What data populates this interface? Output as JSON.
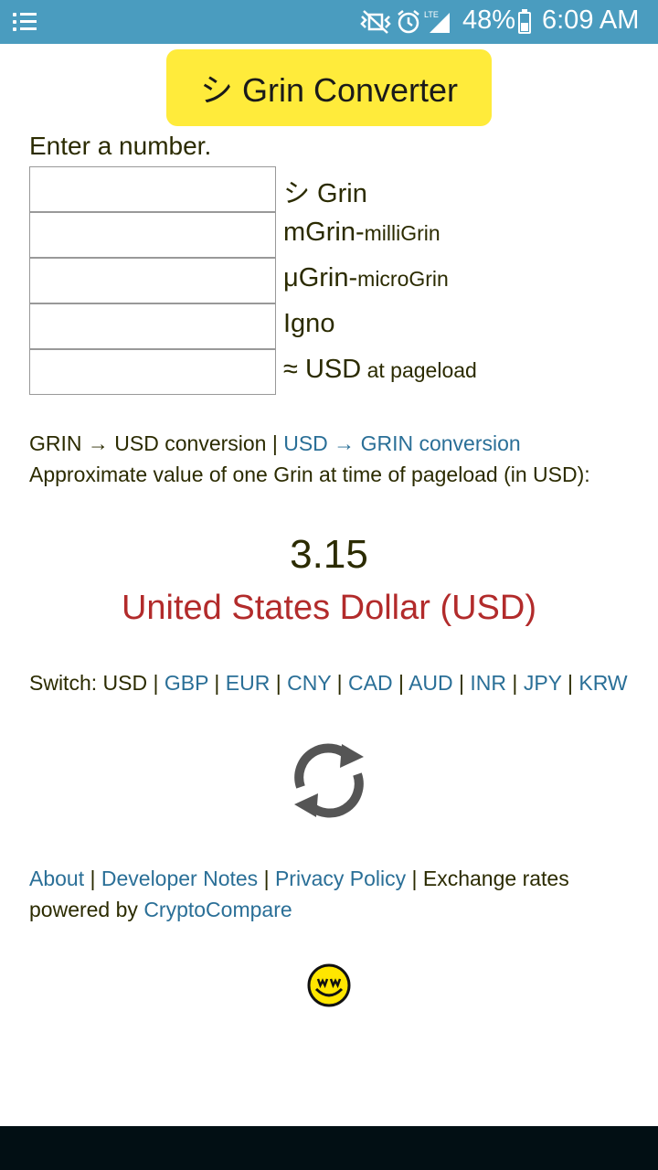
{
  "status_bar": {
    "battery_percent": "48%",
    "time": "6:09 AM",
    "network_label": "LTE"
  },
  "header": {
    "title": "シ Grin Converter"
  },
  "form": {
    "prompt": "Enter a number.",
    "fields": [
      {
        "unit": "シ Grin",
        "sub": ""
      },
      {
        "unit": "mGrin-",
        "sub": "milliGrin"
      },
      {
        "unit": "μGrin-",
        "sub": "microGrin"
      },
      {
        "unit": "Igno",
        "sub": ""
      },
      {
        "unit": "≈ USD",
        "sub": " at pageload"
      }
    ]
  },
  "conversion": {
    "active": "GRIN → USD conversion",
    "separator": " | ",
    "alternate": "USD → GRIN conversion",
    "approx_text": "Approximate value of one Grin at time of pageload (in USD):",
    "value": "3.15",
    "currency_name": "United States Dollar (USD)"
  },
  "switch": {
    "label": "Switch: ",
    "current": "USD",
    "options": [
      "GBP",
      "EUR",
      "CNY",
      "CAD",
      "AUD",
      "INR",
      "JPY",
      "KRW"
    ]
  },
  "footer": {
    "about": "About",
    "developer_notes": "Developer Notes",
    "privacy_policy": "Privacy Policy",
    "rates_text": "Exchange rates powered by ",
    "cryptocompare": "CryptoCompare"
  },
  "colors": {
    "status_bar": "#4a9cbf",
    "title_button": "#ffeb3b",
    "link": "#2a6f97",
    "currency": "#b22b2b",
    "navbar": "#020f14"
  },
  "icons": [
    "menu-icon",
    "vibrate-mute-icon",
    "alarm-icon",
    "signal-icon",
    "battery-charging-icon",
    "refresh-icon",
    "grin-logo-icon"
  ]
}
